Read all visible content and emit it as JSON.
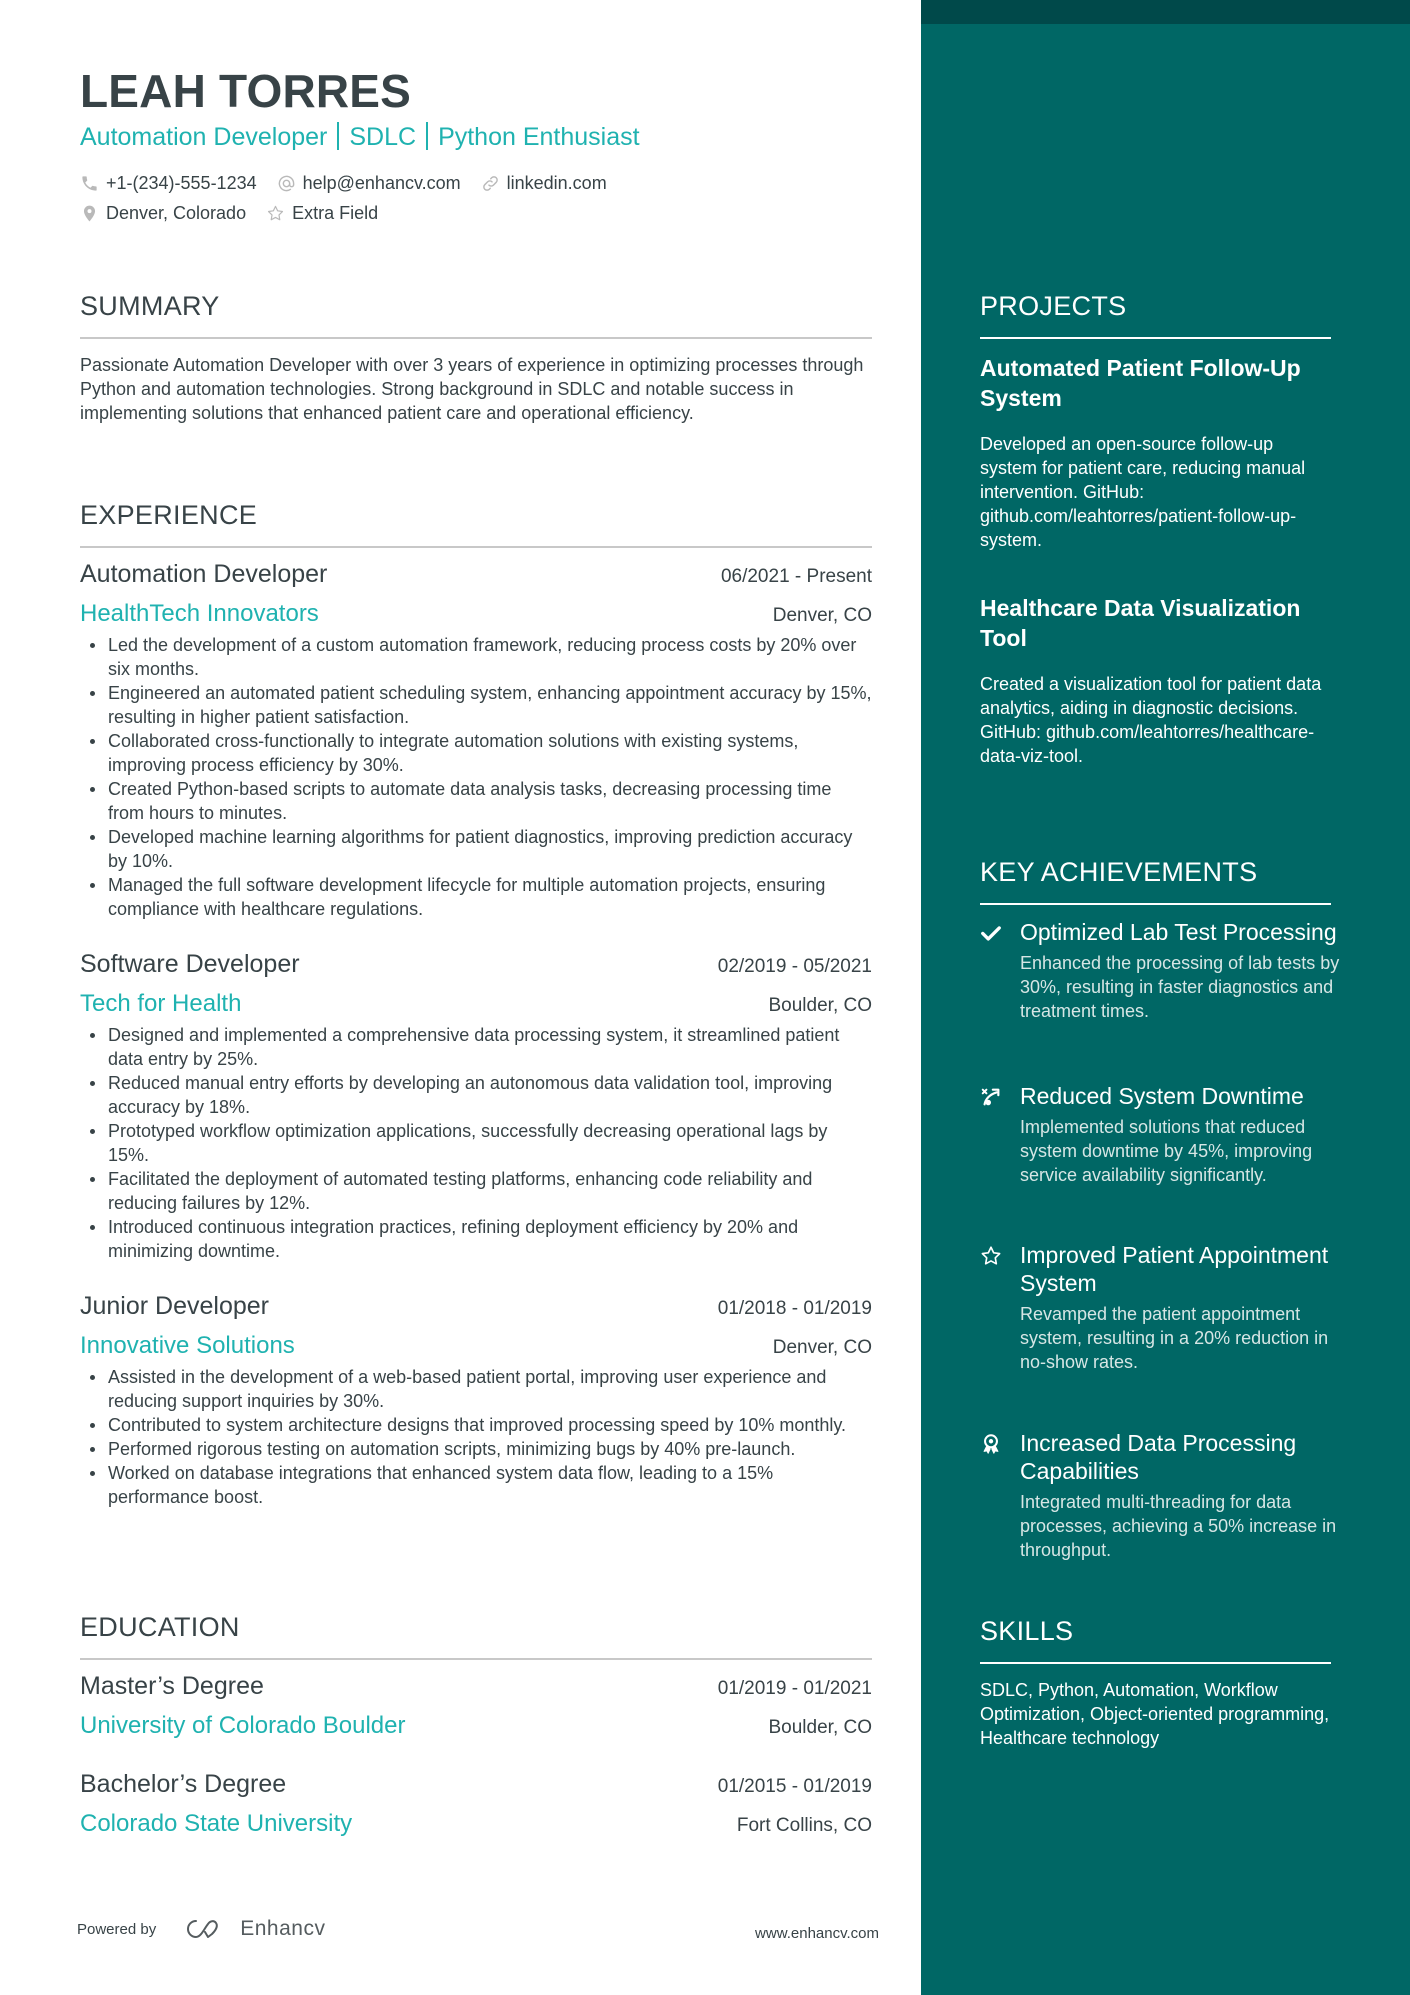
{
  "colors": {
    "accent": "#1fb2b0",
    "sidebar": "#006765",
    "sidebar_band": "#00494a",
    "text": "#384347"
  },
  "header": {
    "name": "LEAH TORRES",
    "tagline_parts": [
      "Automation Developer",
      "SDLC",
      "Python Enthusiast"
    ],
    "contacts": {
      "phone": {
        "icon": "phone-icon",
        "text": "+1-(234)-555-1234"
      },
      "email": {
        "icon": "at-icon",
        "text": "help@enhancv.com"
      },
      "link": {
        "icon": "link-icon",
        "text": "linkedin.com"
      },
      "location": {
        "icon": "location-pin-icon",
        "text": "Denver, Colorado"
      },
      "extra": {
        "icon": "star-icon",
        "text": "Extra Field"
      }
    }
  },
  "summary": {
    "title": "SUMMARY",
    "text": "Passionate Automation Developer with over 3 years of experience in optimizing processes through Python and automation technologies. Strong background in SDLC and notable success in implementing solutions that enhanced patient care and operational efficiency."
  },
  "experience": {
    "title": "EXPERIENCE",
    "jobs": [
      {
        "title": "Automation Developer",
        "dates": "06/2021 - Present",
        "company": "HealthTech Innovators",
        "location": "Denver, CO",
        "bullets": [
          "Led the development of a custom automation framework, reducing process costs by 20% over six months.",
          "Engineered an automated patient scheduling system, enhancing appointment accuracy by 15%, resulting in higher patient satisfaction.",
          "Collaborated cross-functionally to integrate automation solutions with existing systems, improving process efficiency by 30%.",
          "Created Python-based scripts to automate data analysis tasks, decreasing processing time from hours to minutes.",
          "Developed machine learning algorithms for patient diagnostics, improving prediction accuracy by 10%.",
          "Managed the full software development lifecycle for multiple automation projects, ensuring compliance with healthcare regulations."
        ]
      },
      {
        "title": "Software Developer",
        "dates": "02/2019 - 05/2021",
        "company": "Tech for Health",
        "location": "Boulder, CO",
        "bullets": [
          "Designed and implemented a comprehensive data processing system, it streamlined patient data entry by 25%.",
          "Reduced manual entry efforts by developing an autonomous data validation tool, improving accuracy by 18%.",
          "Prototyped workflow optimization applications, successfully decreasing operational lags by 15%.",
          "Facilitated the deployment of automated testing platforms, enhancing code reliability and reducing failures by 12%.",
          "Introduced continuous integration practices, refining deployment efficiency by 20% and minimizing downtime."
        ]
      },
      {
        "title": "Junior Developer",
        "dates": "01/2018 - 01/2019",
        "company": "Innovative Solutions",
        "location": "Denver, CO",
        "bullets": [
          "Assisted in the development of a web-based patient portal, improving user experience and reducing support inquiries by 30%.",
          "Contributed to system architecture designs that improved processing speed by 10% monthly.",
          "Performed rigorous testing on automation scripts, minimizing bugs by 40% pre-launch.",
          "Worked on database integrations that enhanced system data flow, leading to a 15% performance boost."
        ]
      }
    ]
  },
  "education": {
    "title": "EDUCATION",
    "items": [
      {
        "degree": "Master’s Degree",
        "dates": "01/2019 - 01/2021",
        "school": "University of Colorado Boulder",
        "location": "Boulder, CO"
      },
      {
        "degree": "Bachelor’s Degree",
        "dates": "01/2015 - 01/2019",
        "school": "Colorado State University",
        "location": "Fort Collins, CO"
      }
    ]
  },
  "projects": {
    "title": "PROJECTS",
    "items": [
      {
        "title": "Automated Patient Follow-Up System",
        "description": "Developed an open-source follow-up system for patient care, reducing manual intervention. GitHub: github.com/leahtorres/patient-follow-up-system."
      },
      {
        "title": "Healthcare Data Visualization Tool",
        "description": "Created a visualization tool for patient data analytics, aiding in diagnostic decisions. GitHub: github.com/leahtorres/healthcare-data-viz-tool."
      }
    ]
  },
  "achievements": {
    "title": "KEY ACHIEVEMENTS",
    "items": [
      {
        "icon": "checkmark-icon",
        "title": "Optimized Lab Test Processing",
        "description": "Enhanced the processing of lab tests by 30%, resulting in faster diagnostics and treatment times."
      },
      {
        "icon": "strategy-path-icon",
        "title": "Reduced System Downtime",
        "description": "Implemented solutions that reduced system downtime by 45%, improving service availability significantly."
      },
      {
        "icon": "star-icon",
        "title": "Improved Patient Appointment System",
        "description": "Revamped the patient appointment system, resulting in a 20% reduction in no-show rates."
      },
      {
        "icon": "award-medal-icon",
        "title": "Increased Data Processing Capabilities",
        "description": "Integrated multi-threading for data processes, achieving a 50% increase in throughput."
      }
    ]
  },
  "skills": {
    "title": "SKILLS",
    "text": "SDLC, Python, Automation, Workflow Optimization, Object-oriented programming, Healthcare technology"
  },
  "footer": {
    "powered_by": "Powered by",
    "brand": "Enhancv",
    "website": "www.enhancv.com"
  }
}
